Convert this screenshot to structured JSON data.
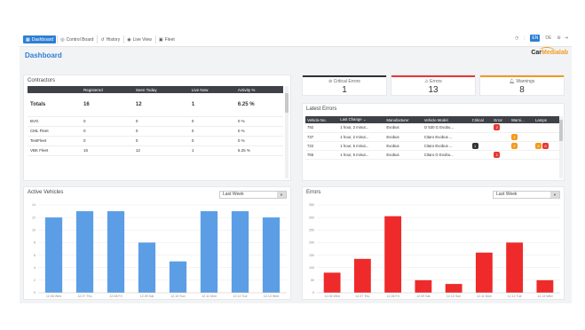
{
  "nav": {
    "items": [
      {
        "icon": "grid-icon",
        "glyph": "▦",
        "label": "Dashboard",
        "active": true
      },
      {
        "icon": "gauge-icon",
        "glyph": "◎",
        "label": "Control Board",
        "active": false
      },
      {
        "icon": "history-icon",
        "glyph": "↺",
        "label": "History",
        "active": false
      },
      {
        "icon": "eye-icon",
        "glyph": "◉",
        "label": "Live View",
        "active": false
      },
      {
        "icon": "bus-icon",
        "glyph": "▣",
        "label": "Fleet",
        "active": false
      }
    ],
    "languages": [
      "EN",
      "DE"
    ],
    "active_language": "EN"
  },
  "page": {
    "title": "Dashboard",
    "logo_main": "Car",
    "logo_accent": "Medialab"
  },
  "contractors": {
    "title": "Contractors",
    "columns": [
      "",
      "Registered",
      "Seen Today",
      "Live Now",
      "Activity %"
    ],
    "totals": [
      "Totals",
      "16",
      "12",
      "1",
      "6.25 %"
    ],
    "rows": [
      [
        "BVG",
        "0",
        "0",
        "0",
        "0 %"
      ],
      [
        "CML Fleet",
        "0",
        "0",
        "0",
        "0 %"
      ],
      [
        "TestFleet",
        "0",
        "0",
        "0",
        "0 %"
      ],
      [
        "VBK Fleet",
        "16",
        "12",
        "1",
        "6.25 %"
      ]
    ]
  },
  "stats": {
    "critical": {
      "label": "Critical Errors",
      "value": "1",
      "color": "#333333"
    },
    "errors": {
      "label": "Errors",
      "value": "13",
      "color": "#e53935"
    },
    "warnings": {
      "label": "Warnings",
      "value": "8",
      "color": "#f29a1e"
    }
  },
  "latest_errors": {
    "title": "Latest Errors",
    "columns": [
      "Vehicle No.",
      "Last Change",
      "Manufacturer",
      "Vehicle Model",
      "Critical",
      "Error",
      "Warni...",
      "Lamps"
    ],
    "rows": [
      {
        "vehicle": "792",
        "change": "1 hour, 2 minut...",
        "manufacturer": "Evobus",
        "model": "O 530 G Evobu...",
        "critical": "",
        "error": "2",
        "warning": "",
        "lamps": []
      },
      {
        "vehicle": "737",
        "change": "1 hour, 2 minut...",
        "manufacturer": "Evobus",
        "model": "Citaro Evobus ...",
        "critical": "",
        "error": "",
        "warning": "1",
        "lamps": []
      },
      {
        "vehicle": "722",
        "change": "1 hour, 5 minut...",
        "manufacturer": "Evobus",
        "model": "Citaro Evobus ...",
        "critical": "1",
        "error": "",
        "warning": "2",
        "lamps": [
          "orange",
          "red"
        ]
      },
      {
        "vehicle": "765",
        "change": "1 hour, 5 minut...",
        "manufacturer": "Evobus",
        "model": "Citaro G Evobu...",
        "critical": "",
        "error": "1",
        "warning": "",
        "lamps": []
      }
    ]
  },
  "charts": {
    "period": "Last Week"
  },
  "chart_data": [
    {
      "type": "bar",
      "title": "Active Vehicles",
      "categories": [
        "12.06 Wed",
        "12.07 Thu",
        "12.08 Fri",
        "12.09 Sat",
        "12.10 Sun",
        "12.11 Mon",
        "12.12 Tue",
        "12.13 Wed"
      ],
      "values": [
        12,
        13,
        13,
        8,
        5,
        13,
        13,
        12
      ],
      "ylim": [
        0,
        14
      ],
      "yticks": [
        0,
        2,
        4,
        6,
        8,
        10,
        12,
        14
      ],
      "color": "#5b9ee6"
    },
    {
      "type": "bar",
      "title": "Errors",
      "categories": [
        "12.06 Wed",
        "12.07 Thu",
        "12.08 Fri",
        "12.09 Sat",
        "12.10 Sun",
        "12.11 Mon",
        "12.12 Tue",
        "12.13 Wed"
      ],
      "values": [
        80,
        135,
        305,
        50,
        35,
        160,
        200,
        50
      ],
      "ylim": [
        0,
        350
      ],
      "yticks": [
        0,
        50,
        100,
        150,
        200,
        250,
        300,
        350
      ],
      "color": "#ee2a2a"
    }
  ]
}
